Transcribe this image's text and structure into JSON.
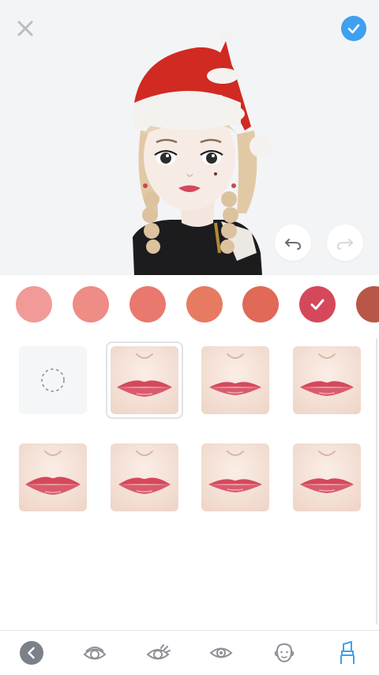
{
  "app": {
    "screen": "lip-color-editor"
  },
  "toolbar": {
    "close_icon": "close-icon",
    "confirm_icon": "check-icon",
    "undo_icon": "undo-icon",
    "redo_icon": "redo-icon"
  },
  "palette": {
    "selected_index": 5,
    "colors": [
      "#f19a98",
      "#ee8c86",
      "#e9786f",
      "#e77b62",
      "#e06957",
      "#d5485c",
      "#b85648"
    ]
  },
  "styles": {
    "selected_index": 1,
    "items": [
      "none",
      "lip-style-1",
      "lip-style-2",
      "lip-style-3",
      "lip-style-4",
      "lip-style-5",
      "lip-style-6",
      "lip-style-7"
    ]
  },
  "colors": {
    "accent": "#3ea0ef",
    "nav_active": "#3ea0ef",
    "nav_inactive": "#8c9097",
    "preview_bg": "#f3f4f6",
    "hat_red": "#d02a22"
  },
  "bottom_nav": {
    "active_index": 5,
    "items": [
      "back-icon",
      "eyeshadow-icon",
      "eyelash-icon",
      "eye-icon",
      "face-icon",
      "lipstick-icon"
    ]
  }
}
